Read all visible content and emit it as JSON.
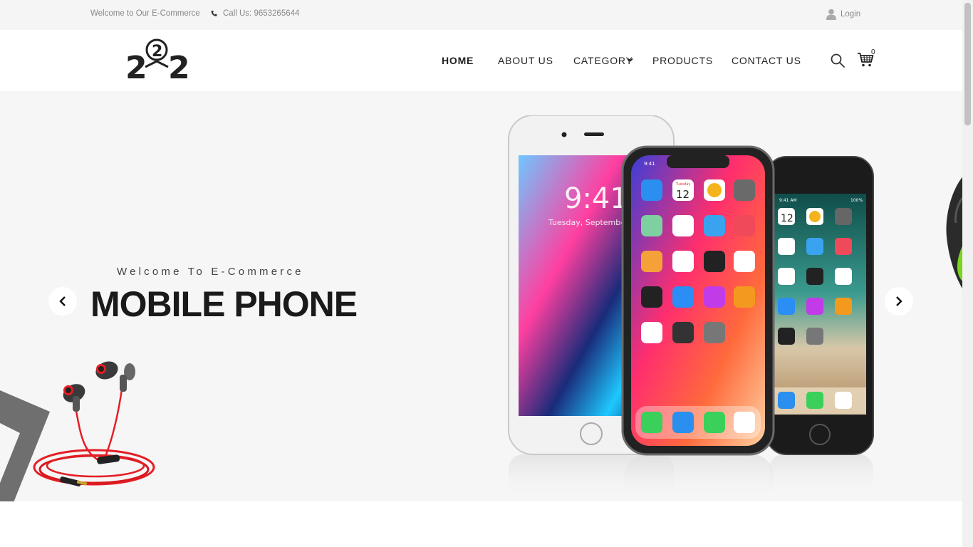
{
  "topbar": {
    "welcome": "Welcome to Our E-Commerce",
    "call": "Call Us: 9653265644",
    "login": "Login",
    "phone_icon": "phone-icon",
    "user_icon": "user-icon"
  },
  "logo": {
    "text_left": "2",
    "text_middle": "2",
    "text_right": "2"
  },
  "nav": {
    "items": [
      {
        "label": "HOME"
      },
      {
        "label": "ABOUT US"
      },
      {
        "label": "CATEGORY"
      },
      {
        "label": "PRODUCTS"
      },
      {
        "label": "CONTACT US"
      }
    ],
    "cart_count": "0"
  },
  "hero": {
    "subtitle": "Welcome To E-Commerce",
    "title": "MOBILE PHONE",
    "phone_a": {
      "time": "9:41",
      "date": "Tuesday, Septembe"
    },
    "phone_b": {
      "status_time": "9:41",
      "calendar_day": "Tuesday",
      "calendar_date": "12"
    },
    "phone_c": {
      "status_time": "9:41 AM",
      "battery": "100%",
      "calendar_date": "12"
    }
  },
  "colors": {
    "topbar_bg": "#f5f5f5",
    "hero_bg": "#f6f6f6",
    "text_dark": "#1a1a1a",
    "earphone_red": "#e41e25"
  }
}
